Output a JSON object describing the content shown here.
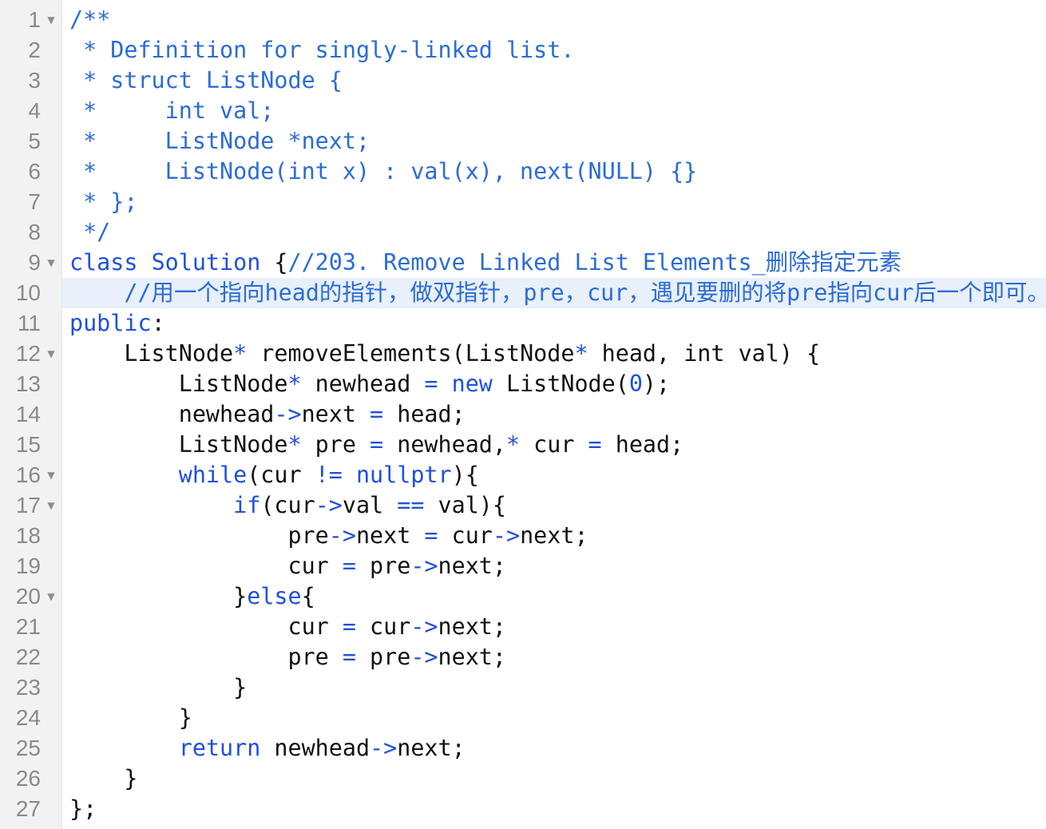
{
  "editor": {
    "active_line": 10,
    "colors": {
      "comment": "#2b6cd6",
      "keyword": "#1f4fe0",
      "operator": "#2350d8",
      "text": "#111111",
      "gutter_bg": "#f2f2f2",
      "gutter_text": "#8a8a8a",
      "active_line_bg": "#e8f0fb"
    },
    "lines": [
      {
        "n": "1",
        "fold": true,
        "tokens": [
          {
            "t": "cm",
            "v": "/**"
          }
        ]
      },
      {
        "n": "2",
        "fold": false,
        "tokens": [
          {
            "t": "cm",
            "v": " * Definition for singly-linked list."
          }
        ]
      },
      {
        "n": "3",
        "fold": false,
        "tokens": [
          {
            "t": "cm",
            "v": " * struct ListNode {"
          }
        ]
      },
      {
        "n": "4",
        "fold": false,
        "tokens": [
          {
            "t": "cm",
            "v": " *     int val;"
          }
        ]
      },
      {
        "n": "5",
        "fold": false,
        "tokens": [
          {
            "t": "cm",
            "v": " *     ListNode *next;"
          }
        ]
      },
      {
        "n": "6",
        "fold": false,
        "tokens": [
          {
            "t": "cm",
            "v": " *     ListNode(int x) : val(x), next(NULL) {}"
          }
        ]
      },
      {
        "n": "7",
        "fold": false,
        "tokens": [
          {
            "t": "cm",
            "v": " * };"
          }
        ]
      },
      {
        "n": "8",
        "fold": false,
        "tokens": [
          {
            "t": "cm",
            "v": " */"
          }
        ]
      },
      {
        "n": "9",
        "fold": true,
        "tokens": [
          {
            "t": "kw",
            "v": "class"
          },
          {
            "t": "pl",
            "v": " "
          },
          {
            "t": "kw",
            "v": "Solution"
          },
          {
            "t": "pl",
            "v": " {"
          },
          {
            "t": "cm",
            "v": "//203. Remove Linked List Elements_删除指定元素"
          }
        ]
      },
      {
        "n": "10",
        "fold": false,
        "tokens": [
          {
            "t": "pl",
            "v": "    "
          },
          {
            "t": "cm",
            "v": "//用一个指向head的指针，做双指针，pre，cur，遇见要删的将pre指向cur后一个即可。"
          }
        ]
      },
      {
        "n": "11",
        "fold": false,
        "tokens": [
          {
            "t": "kw",
            "v": "public"
          },
          {
            "t": "pl",
            "v": ":"
          }
        ]
      },
      {
        "n": "12",
        "fold": true,
        "tokens": [
          {
            "t": "pl",
            "v": "    ListNode"
          },
          {
            "t": "op",
            "v": "*"
          },
          {
            "t": "pl",
            "v": " removeElements(ListNode"
          },
          {
            "t": "op",
            "v": "*"
          },
          {
            "t": "pl",
            "v": " head, int val) {"
          }
        ]
      },
      {
        "n": "13",
        "fold": false,
        "tokens": [
          {
            "t": "pl",
            "v": "        ListNode"
          },
          {
            "t": "op",
            "v": "*"
          },
          {
            "t": "pl",
            "v": " newhead "
          },
          {
            "t": "op",
            "v": "="
          },
          {
            "t": "pl",
            "v": " "
          },
          {
            "t": "kw",
            "v": "new"
          },
          {
            "t": "pl",
            "v": " ListNode("
          },
          {
            "t": "cn",
            "v": "0"
          },
          {
            "t": "pl",
            "v": ");"
          }
        ]
      },
      {
        "n": "14",
        "fold": false,
        "tokens": [
          {
            "t": "pl",
            "v": "        newhead"
          },
          {
            "t": "op",
            "v": "->"
          },
          {
            "t": "pl",
            "v": "next "
          },
          {
            "t": "op",
            "v": "="
          },
          {
            "t": "pl",
            "v": " head;"
          }
        ]
      },
      {
        "n": "15",
        "fold": false,
        "tokens": [
          {
            "t": "pl",
            "v": "        ListNode"
          },
          {
            "t": "op",
            "v": "*"
          },
          {
            "t": "pl",
            "v": " pre "
          },
          {
            "t": "op",
            "v": "="
          },
          {
            "t": "pl",
            "v": " newhead,"
          },
          {
            "t": "op",
            "v": "*"
          },
          {
            "t": "pl",
            "v": " cur "
          },
          {
            "t": "op",
            "v": "="
          },
          {
            "t": "pl",
            "v": " head;"
          }
        ]
      },
      {
        "n": "16",
        "fold": true,
        "tokens": [
          {
            "t": "pl",
            "v": "        "
          },
          {
            "t": "kw",
            "v": "while"
          },
          {
            "t": "pl",
            "v": "(cur "
          },
          {
            "t": "op",
            "v": "!="
          },
          {
            "t": "pl",
            "v": " "
          },
          {
            "t": "kw",
            "v": "nullptr"
          },
          {
            "t": "pl",
            "v": "){"
          }
        ]
      },
      {
        "n": "17",
        "fold": true,
        "tokens": [
          {
            "t": "pl",
            "v": "            "
          },
          {
            "t": "kw",
            "v": "if"
          },
          {
            "t": "pl",
            "v": "(cur"
          },
          {
            "t": "op",
            "v": "->"
          },
          {
            "t": "pl",
            "v": "val "
          },
          {
            "t": "op",
            "v": "=="
          },
          {
            "t": "pl",
            "v": " val){"
          }
        ]
      },
      {
        "n": "18",
        "fold": false,
        "tokens": [
          {
            "t": "pl",
            "v": "                pre"
          },
          {
            "t": "op",
            "v": "->"
          },
          {
            "t": "pl",
            "v": "next "
          },
          {
            "t": "op",
            "v": "="
          },
          {
            "t": "pl",
            "v": " cur"
          },
          {
            "t": "op",
            "v": "->"
          },
          {
            "t": "pl",
            "v": "next;"
          }
        ]
      },
      {
        "n": "19",
        "fold": false,
        "tokens": [
          {
            "t": "pl",
            "v": "                cur "
          },
          {
            "t": "op",
            "v": "="
          },
          {
            "t": "pl",
            "v": " pre"
          },
          {
            "t": "op",
            "v": "->"
          },
          {
            "t": "pl",
            "v": "next;"
          }
        ]
      },
      {
        "n": "20",
        "fold": true,
        "tokens": [
          {
            "t": "pl",
            "v": "            }"
          },
          {
            "t": "kw",
            "v": "else"
          },
          {
            "t": "pl",
            "v": "{"
          }
        ]
      },
      {
        "n": "21",
        "fold": false,
        "tokens": [
          {
            "t": "pl",
            "v": "                cur "
          },
          {
            "t": "op",
            "v": "="
          },
          {
            "t": "pl",
            "v": " cur"
          },
          {
            "t": "op",
            "v": "->"
          },
          {
            "t": "pl",
            "v": "next;"
          }
        ]
      },
      {
        "n": "22",
        "fold": false,
        "tokens": [
          {
            "t": "pl",
            "v": "                pre "
          },
          {
            "t": "op",
            "v": "="
          },
          {
            "t": "pl",
            "v": " pre"
          },
          {
            "t": "op",
            "v": "->"
          },
          {
            "t": "pl",
            "v": "next;"
          }
        ]
      },
      {
        "n": "23",
        "fold": false,
        "tokens": [
          {
            "t": "pl",
            "v": "            }"
          }
        ]
      },
      {
        "n": "24",
        "fold": false,
        "tokens": [
          {
            "t": "pl",
            "v": "        }"
          }
        ]
      },
      {
        "n": "25",
        "fold": false,
        "tokens": [
          {
            "t": "pl",
            "v": "        "
          },
          {
            "t": "kw",
            "v": "return"
          },
          {
            "t": "pl",
            "v": " newhead"
          },
          {
            "t": "op",
            "v": "->"
          },
          {
            "t": "pl",
            "v": "next;"
          }
        ]
      },
      {
        "n": "26",
        "fold": false,
        "tokens": [
          {
            "t": "pl",
            "v": "    }"
          }
        ]
      },
      {
        "n": "27",
        "fold": false,
        "tokens": [
          {
            "t": "pl",
            "v": "};"
          }
        ]
      }
    ]
  }
}
